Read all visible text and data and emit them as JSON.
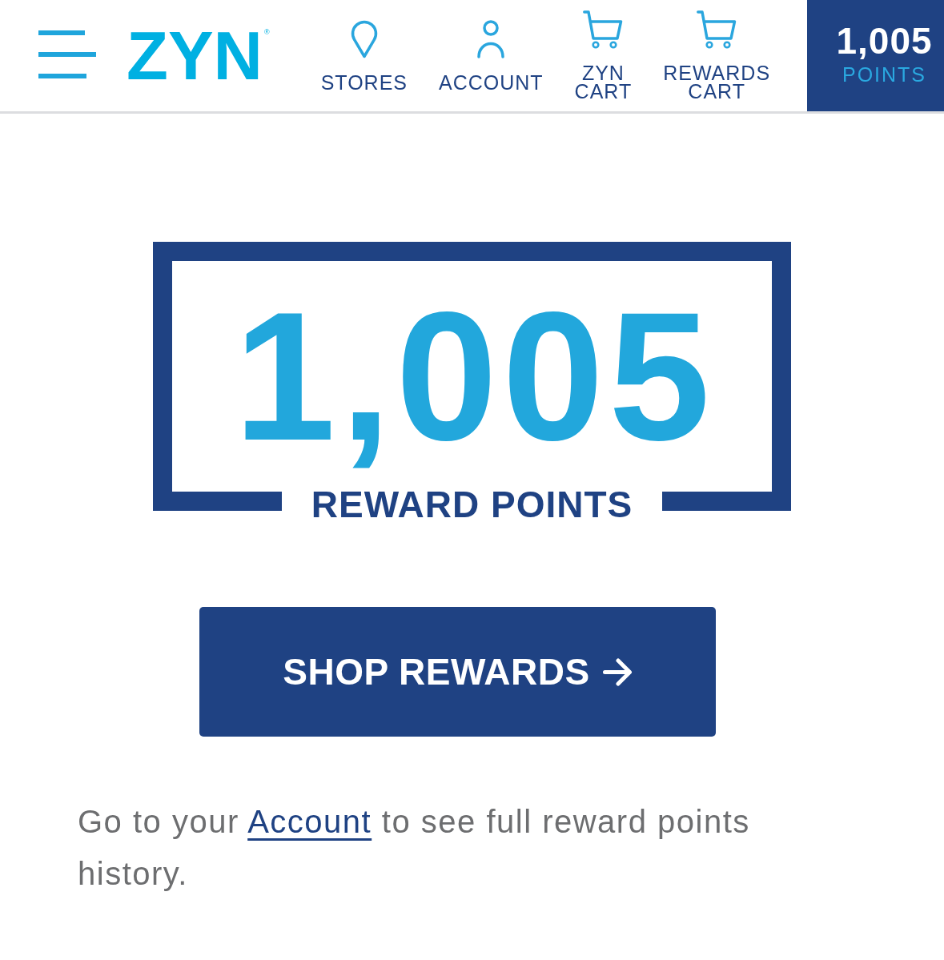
{
  "header": {
    "logo": {
      "text": "ZYN",
      "mark": "®"
    },
    "nav": [
      {
        "kind": "pin",
        "label": "STORES"
      },
      {
        "kind": "person",
        "label": "ACCOUNT"
      },
      {
        "kind": "cart",
        "label": "ZYN CART"
      },
      {
        "kind": "cart",
        "label": "REWARDS CART"
      }
    ],
    "points_badge": {
      "value": "1,005",
      "label": "POINTS"
    }
  },
  "rewards": {
    "points": "1,005",
    "label": "REWARD POINTS"
  },
  "shop_button": {
    "label": "SHOP REWARDS"
  },
  "note": {
    "before": "Go to your ",
    "link": "Account",
    "after": " to see full reward points history."
  }
}
